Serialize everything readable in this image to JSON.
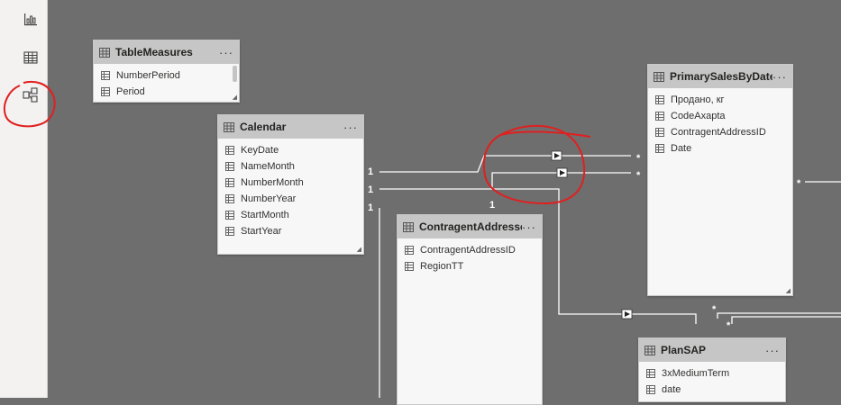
{
  "nav": {
    "report_icon": "bar-chart-icon",
    "data_icon": "table-grid-icon",
    "model_icon": "model-view-icon"
  },
  "tables": {
    "measures": {
      "title": "TableMeasures",
      "more": "···",
      "fields": [
        "NumberPeriod",
        "Period"
      ]
    },
    "calendar": {
      "title": "Calendar",
      "more": "···",
      "fields": [
        "KeyDate",
        "NameMonth",
        "NumberMonth",
        "NumberYear",
        "StartMonth",
        "StartYear"
      ]
    },
    "contragent": {
      "title": "ContragentAddresses",
      "more": "···",
      "fields": [
        "ContragentAddressID",
        "RegionTT"
      ]
    },
    "primary": {
      "title": "PrimarySalesByDate",
      "more": "···",
      "fields": [
        "Продано, кг",
        "CodeAxapta",
        "ContragentAddressID",
        "Date"
      ]
    },
    "plansap": {
      "title": "PlanSAP",
      "more": "···",
      "fields": [
        "3xMediumTerm",
        "date"
      ]
    }
  },
  "cardinality": {
    "one_1": "1",
    "one_2": "1",
    "one_3": "1",
    "one_4": "1",
    "many_1": "*",
    "many_2": "*",
    "many_3": "*",
    "many_4": "*",
    "many_5": "*"
  },
  "colors": {
    "canvas": "#6e6e6e",
    "header": "#c6c6c6",
    "annotation": "#e02020"
  }
}
